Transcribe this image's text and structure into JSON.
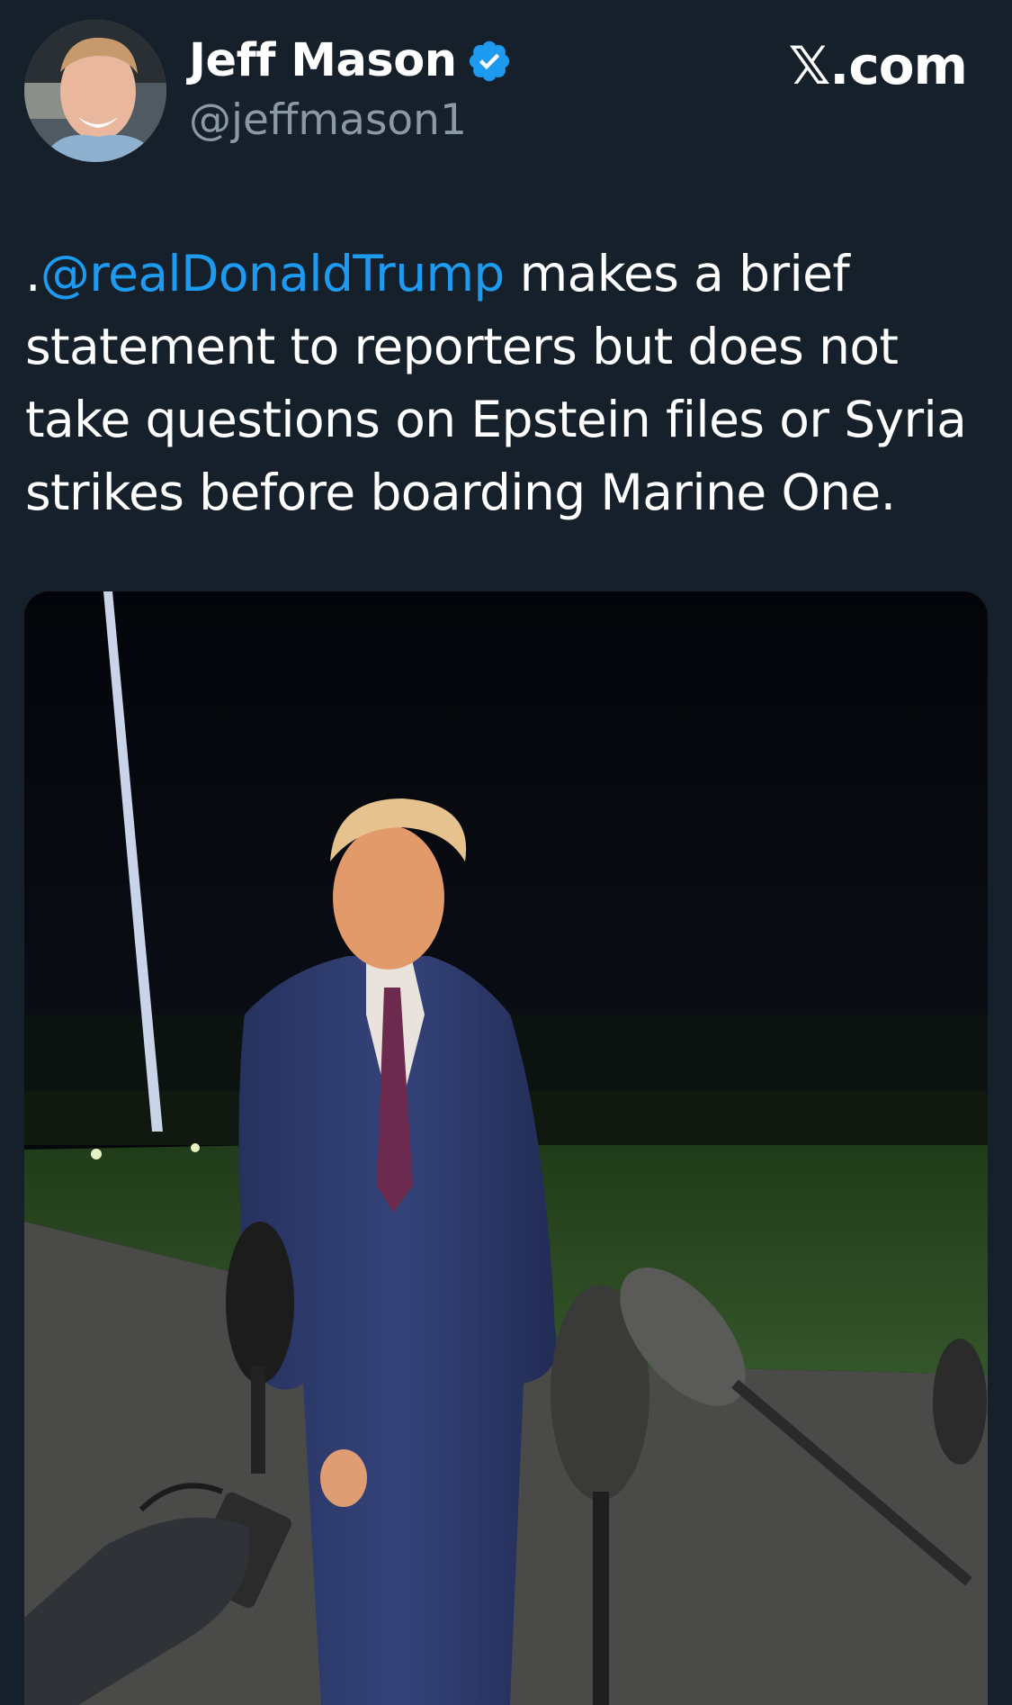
{
  "author": {
    "display_name": "Jeff Mason",
    "handle": "@jeffmason1",
    "verified": true,
    "avatar_icon": "profile-photo"
  },
  "brand": "𝕏.com",
  "tweet": {
    "prefix": ".",
    "mention": "@realDonaldTrump",
    "body": " makes a brief statement to reporters but does not take questions on Epstein files or Syria strikes before boarding Marine One."
  },
  "colors": {
    "background": "#15202b",
    "text": "#ffffff",
    "secondary_text": "#8b98a5",
    "link": "#1d9bf0",
    "verified_badge": "#1d9bf0"
  },
  "media": {
    "type": "photo"
  }
}
